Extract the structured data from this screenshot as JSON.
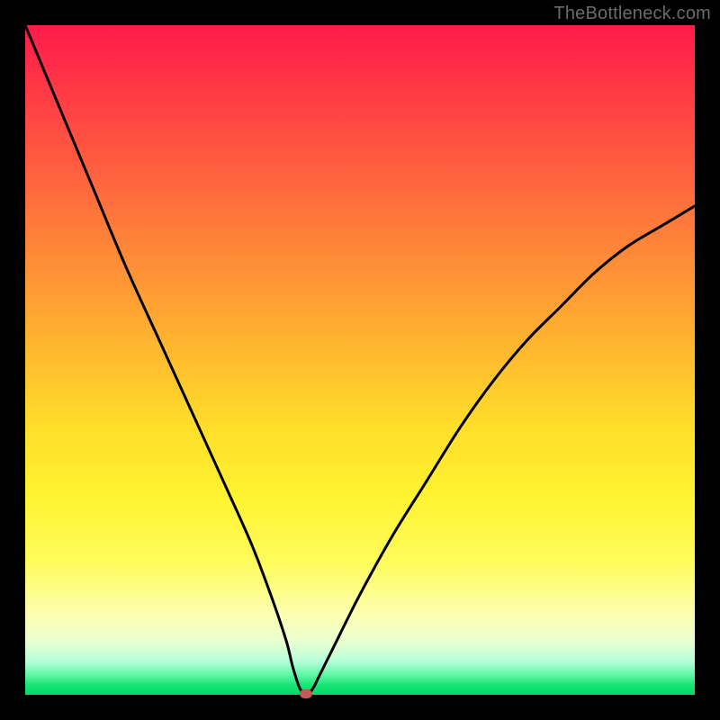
{
  "watermark": "TheBottleneck.com",
  "chart_data": {
    "type": "line",
    "title": "",
    "xlabel": "",
    "ylabel": "",
    "xlim": [
      0,
      100
    ],
    "ylim": [
      0,
      100
    ],
    "grid": false,
    "series": [
      {
        "name": "bottleneck-curve",
        "x": [
          0,
          5,
          10,
          15,
          20,
          25,
          30,
          34,
          37,
          39,
          40,
          41,
          42,
          43,
          44,
          46,
          50,
          55,
          60,
          65,
          70,
          75,
          80,
          85,
          90,
          95,
          100
        ],
        "y": [
          100,
          88,
          76,
          64,
          53,
          42,
          31,
          22,
          14,
          8,
          4,
          1,
          0,
          1,
          3,
          7,
          15,
          24,
          32,
          40,
          47,
          53,
          58,
          63,
          67,
          70,
          73
        ]
      }
    ],
    "marker": {
      "x": 42,
      "y": 0,
      "color": "#c25b55"
    },
    "background_gradient": {
      "stops": [
        {
          "pos": 0.0,
          "color": "#ff1a4a"
        },
        {
          "pos": 0.5,
          "color": "#ffbd2e"
        },
        {
          "pos": 0.8,
          "color": "#fffc5a"
        },
        {
          "pos": 0.95,
          "color": "#b6ffd9"
        },
        {
          "pos": 1.0,
          "color": "#00d868"
        }
      ]
    }
  }
}
